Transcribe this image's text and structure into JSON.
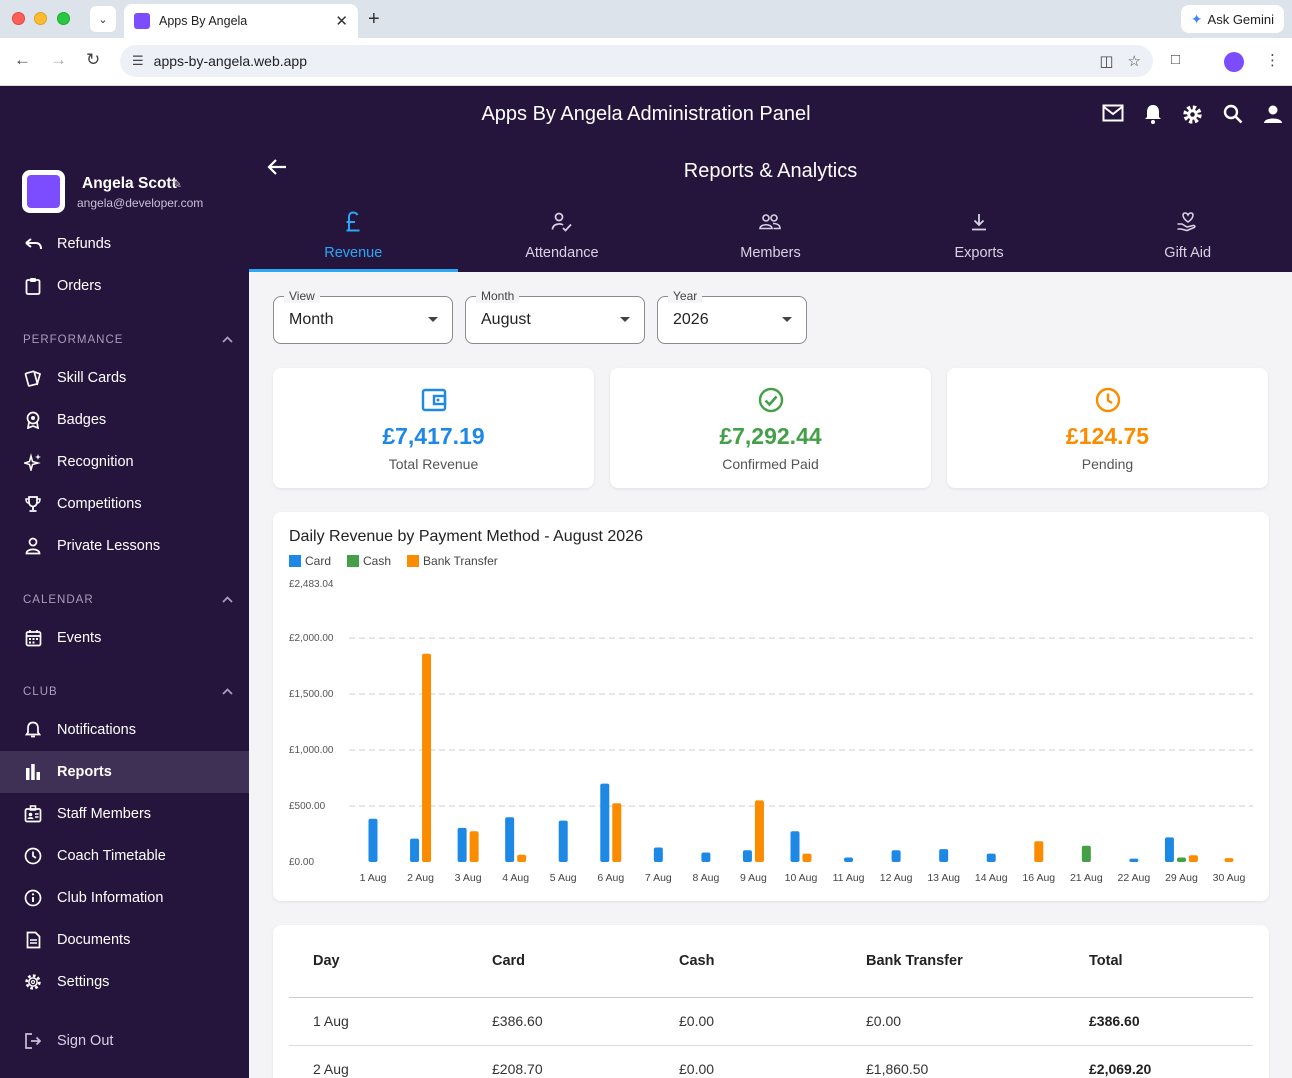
{
  "browser": {
    "tab_title": "Apps By Angela",
    "url": "apps-by-angela.web.app",
    "gemini_label": "Ask Gemini"
  },
  "app": {
    "title": "Apps By Angela Administration Panel"
  },
  "user": {
    "name": "Angela Scott",
    "email": "angela@developer.com"
  },
  "sidebar": {
    "top_items": [
      {
        "label": "Refunds",
        "icon": "undo-icon"
      },
      {
        "label": "Orders",
        "icon": "clipboard-icon"
      }
    ],
    "sections": [
      {
        "title": "PERFORMANCE",
        "items": [
          {
            "label": "Skill Cards",
            "icon": "cards-icon"
          },
          {
            "label": "Badges",
            "icon": "badge-icon"
          },
          {
            "label": "Recognition",
            "icon": "sparkle-icon"
          },
          {
            "label": "Competitions",
            "icon": "trophy-icon"
          },
          {
            "label": "Private Lessons",
            "icon": "person-icon"
          }
        ]
      },
      {
        "title": "CALENDAR",
        "items": [
          {
            "label": "Events",
            "icon": "calendar-icon"
          }
        ]
      },
      {
        "title": "CLUB",
        "items": [
          {
            "label": "Notifications",
            "icon": "bell-icon"
          },
          {
            "label": "Reports",
            "icon": "bar-chart-icon",
            "active": true
          },
          {
            "label": "Staff Members",
            "icon": "id-badge-icon"
          },
          {
            "label": "Coach Timetable",
            "icon": "clock-icon"
          },
          {
            "label": "Club Information",
            "icon": "info-icon"
          },
          {
            "label": "Documents",
            "icon": "document-icon"
          },
          {
            "label": "Settings",
            "icon": "gear-icon"
          }
        ]
      }
    ],
    "sign_out": "Sign Out"
  },
  "page": {
    "title": "Reports & Analytics",
    "tabs": [
      {
        "label": "Revenue",
        "icon": "pound-icon",
        "active": true
      },
      {
        "label": "Attendance",
        "icon": "person-check-icon"
      },
      {
        "label": "Members",
        "icon": "group-icon"
      },
      {
        "label": "Exports",
        "icon": "download-icon"
      },
      {
        "label": "Gift Aid",
        "icon": "heart-hand-icon"
      }
    ]
  },
  "filters": {
    "view": {
      "label": "View",
      "value": "Month"
    },
    "month": {
      "label": "Month",
      "value": "August"
    },
    "year": {
      "label": "Year",
      "value": "2026"
    }
  },
  "stats": [
    {
      "value": "£7,417.19",
      "label": "Total Revenue",
      "color": "#1e88e5",
      "icon": "wallet-icon"
    },
    {
      "value": "£7,292.44",
      "label": "Confirmed Paid",
      "color": "#43a047",
      "icon": "check-circle-icon"
    },
    {
      "value": "£124.75",
      "label": "Pending",
      "color": "#fb8c00",
      "icon": "clock-icon"
    }
  ],
  "colors": {
    "card": "#1e88e5",
    "cash": "#43a047",
    "bank": "#fb8c00"
  },
  "chart_data": {
    "type": "bar",
    "title": "Daily Revenue by Payment Method - August 2026",
    "categories": [
      "1 Aug",
      "2 Aug",
      "3 Aug",
      "4 Aug",
      "5 Aug",
      "6 Aug",
      "7 Aug",
      "8 Aug",
      "9 Aug",
      "10 Aug",
      "11 Aug",
      "12 Aug",
      "13 Aug",
      "14 Aug",
      "16 Aug",
      "21 Aug",
      "22 Aug",
      "29 Aug",
      "30 Aug"
    ],
    "series": [
      {
        "name": "Card",
        "values": [
          386.6,
          208.7,
          305,
          400,
          370,
          700,
          130,
          85,
          105,
          275,
          40,
          105,
          115,
          75,
          0,
          0,
          30,
          220,
          0
        ]
      },
      {
        "name": "Cash",
        "values": [
          0,
          0,
          0,
          0,
          0,
          0,
          0,
          0,
          0,
          0,
          0,
          0,
          0,
          0,
          0,
          145,
          0,
          40,
          0
        ]
      },
      {
        "name": "Bank Transfer",
        "values": [
          0,
          1860.5,
          275,
          65,
          0,
          525,
          0,
          0,
          550,
          75,
          0,
          0,
          0,
          0,
          185,
          0,
          0,
          60,
          35
        ]
      }
    ],
    "ytick_labels": [
      "£0.00",
      "£500.00",
      "£1,000.00",
      "£1,500.00",
      "£2,000.00",
      "£2,483.04"
    ],
    "ytick_values": [
      0,
      500,
      1000,
      1500,
      2000,
      2483.04
    ],
    "ylim": [
      0,
      2483.04
    ],
    "grid": true,
    "legend": "top-left"
  },
  "table": {
    "headers": [
      "Day",
      "Card",
      "Cash",
      "Bank Transfer",
      "Total"
    ],
    "rows": [
      [
        "1 Aug",
        "£386.60",
        "£0.00",
        "£0.00",
        "£386.60"
      ],
      [
        "2 Aug",
        "£208.70",
        "£0.00",
        "£1,860.50",
        "£2,069.20"
      ]
    ]
  }
}
